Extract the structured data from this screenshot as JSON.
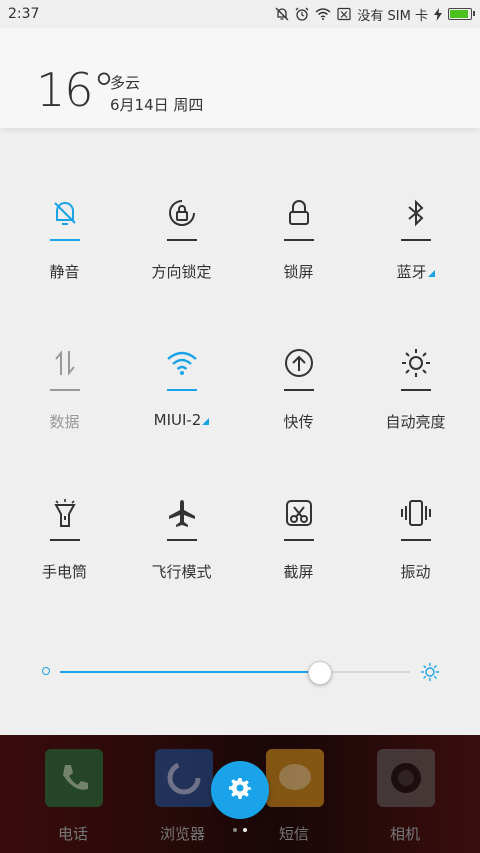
{
  "status": {
    "time": "2:37",
    "carrier": "没有 SIM 卡",
    "battery_level": 0.92,
    "icons": [
      "bell-off-icon",
      "alarm-icon",
      "wifi-icon",
      "no-sim-icon",
      "charging-icon",
      "battery-icon"
    ]
  },
  "weather": {
    "temp": "16°",
    "condition": "多云",
    "date": "6月14日 周四"
  },
  "toggles": [
    {
      "label": "静音",
      "icon": "bell-off-icon",
      "state": "active"
    },
    {
      "label": "方向锁定",
      "icon": "rotation-lock-icon",
      "state": "normal"
    },
    {
      "label": "锁屏",
      "icon": "lock-icon",
      "state": "normal"
    },
    {
      "label": "蓝牙",
      "icon": "bluetooth-icon",
      "state": "normal",
      "more": true
    },
    {
      "label": "数据",
      "icon": "data-icon",
      "state": "disabled"
    },
    {
      "label": "MIUI-2",
      "icon": "wifi-icon",
      "state": "active",
      "more": true
    },
    {
      "label": "快传",
      "icon": "quick-transfer-icon",
      "state": "normal"
    },
    {
      "label": "自动亮度",
      "icon": "auto-brightness-icon",
      "state": "normal"
    },
    {
      "label": "手电筒",
      "icon": "flashlight-icon",
      "state": "normal"
    },
    {
      "label": "飞行模式",
      "icon": "airplane-icon",
      "state": "normal"
    },
    {
      "label": "截屏",
      "icon": "screenshot-icon",
      "state": "normal"
    },
    {
      "label": "振动",
      "icon": "vibrate-icon",
      "state": "normal"
    }
  ],
  "brightness": {
    "level": 0.74
  },
  "dock": {
    "apps": [
      {
        "label": "电话",
        "color": "#1e6e3a"
      },
      {
        "label": "浏览器",
        "color": "#1f4d8c"
      },
      {
        "label": "短信",
        "color": "#c88a1a"
      },
      {
        "label": "相机",
        "color": "#555555"
      }
    ]
  },
  "colors": {
    "accent": "#1aa3e8",
    "text": "#333333",
    "disabled": "#999999"
  }
}
